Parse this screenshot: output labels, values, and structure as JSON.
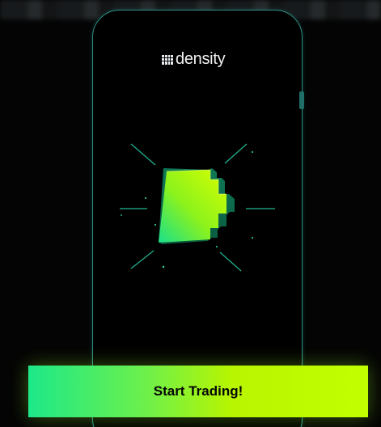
{
  "brand": {
    "name": "density"
  },
  "cta": {
    "label": "Start Trading!"
  },
  "colors": {
    "background": "#040404",
    "phone_outline": "#2e8f86",
    "accent_green": "#1de889",
    "accent_lime": "#c2ff00",
    "cta_text": "#050505"
  },
  "icons": {
    "logo": "density-grid-logo",
    "hero": "pixel-d-3d-icon"
  }
}
